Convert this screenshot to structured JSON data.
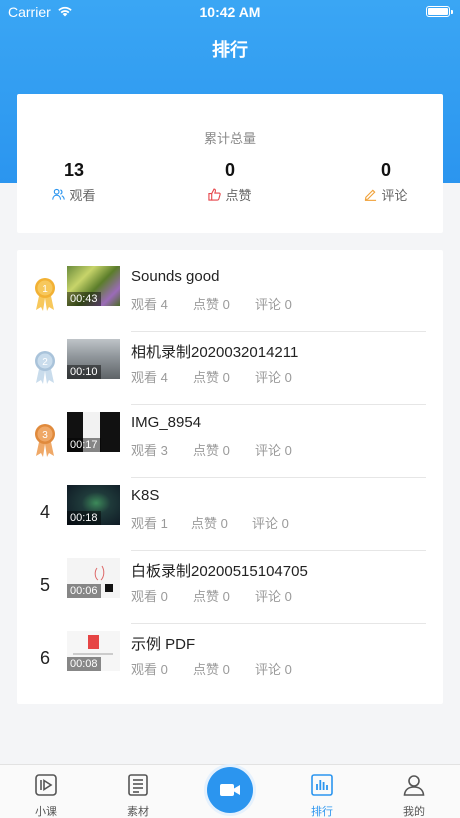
{
  "status": {
    "carrier": "Carrier",
    "time": "10:42 AM"
  },
  "nav": {
    "title": "排行"
  },
  "summary": {
    "label": "累计总量",
    "stats": [
      {
        "value": "13",
        "label": "观看",
        "icon": "users-icon"
      },
      {
        "value": "0",
        "label": "点赞",
        "icon": "thumbs-up-icon"
      },
      {
        "value": "0",
        "label": "评论",
        "icon": "pencil-icon"
      }
    ]
  },
  "ranking": [
    {
      "rank": "1",
      "title": "Sounds good",
      "duration": "00:43",
      "views": "观看 4",
      "likes": "点赞 0",
      "comments": "评论 0"
    },
    {
      "rank": "2",
      "title": "相机录制2020032014211",
      "duration": "00:10",
      "views": "观看 4",
      "likes": "点赞 0",
      "comments": "评论 0"
    },
    {
      "rank": "3",
      "title": "IMG_8954",
      "duration": "00:17",
      "views": "观看 3",
      "likes": "点赞 0",
      "comments": "评论 0"
    },
    {
      "rank": "4",
      "title": "K8S",
      "duration": "00:18",
      "views": "观看 1",
      "likes": "点赞 0",
      "comments": "评论 0"
    },
    {
      "rank": "5",
      "title": "白板录制20200515104705",
      "duration": "00:06",
      "views": "观看 0",
      "likes": "点赞 0",
      "comments": "评论 0"
    },
    {
      "rank": "6",
      "title": "示例 PDF",
      "duration": "00:08",
      "views": "观看 0",
      "likes": "点赞 0",
      "comments": "评论 0"
    }
  ],
  "tabs": [
    {
      "label": "小课",
      "icon": "play-square-icon"
    },
    {
      "label": "素材",
      "icon": "document-icon"
    },
    {
      "label": "",
      "icon": "video-camera-icon"
    },
    {
      "label": "排行",
      "icon": "bar-chart-icon",
      "active": true
    },
    {
      "label": "我的",
      "icon": "user-icon"
    }
  ],
  "colors": {
    "accent": "#2b95ef",
    "gold": "#f2b134",
    "silver": "#a9c3da",
    "bronze": "#e08a3c"
  }
}
